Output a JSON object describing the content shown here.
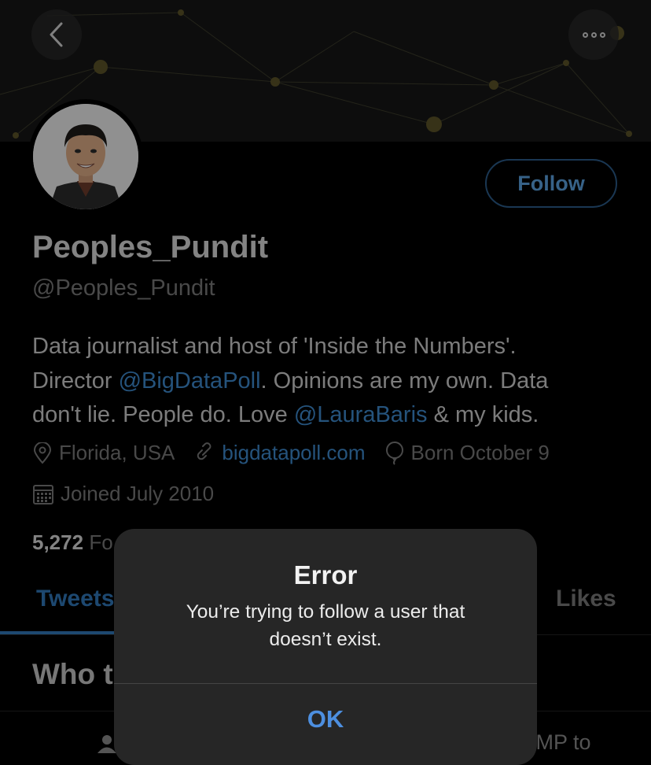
{
  "header": {
    "back_icon": "chevron-left-icon",
    "more_icon": "more-horizontal-icon"
  },
  "profile": {
    "display_name": "Peoples_Pundit",
    "handle": "@Peoples_Pundit",
    "follow_label": "Follow",
    "bio": {
      "line1": "Data journalist and host of 'Inside the Numbers'.",
      "line2_prefix": "Director ",
      "line2_link": "@BigDataPoll",
      "line2_suffix": ". Opinions are my own. Data",
      "line3_prefix": "don't lie. People do. Love ",
      "line3_link": "@LauraBaris",
      "line3_suffix": " & my kids."
    },
    "location": "Florida, USA",
    "website": "bigdatapoll.com",
    "birthday": "Born October 9",
    "joined": "Joined July 2010",
    "following_count": "5,272",
    "following_label_partial": "Fo"
  },
  "tabs": {
    "tweets_partial": "Tweets",
    "likes": "Likes"
  },
  "section": {
    "title_partial": "Who t",
    "jump_partial": "JMP to"
  },
  "alert": {
    "title": "Error",
    "message": "You’re trying to follow a user that doesn’t exist.",
    "ok_label": "OK"
  },
  "colors": {
    "background": "#000000",
    "accent": "#2f74b5",
    "link": "#3d86c9",
    "alert_button": "#4d8fe0"
  }
}
